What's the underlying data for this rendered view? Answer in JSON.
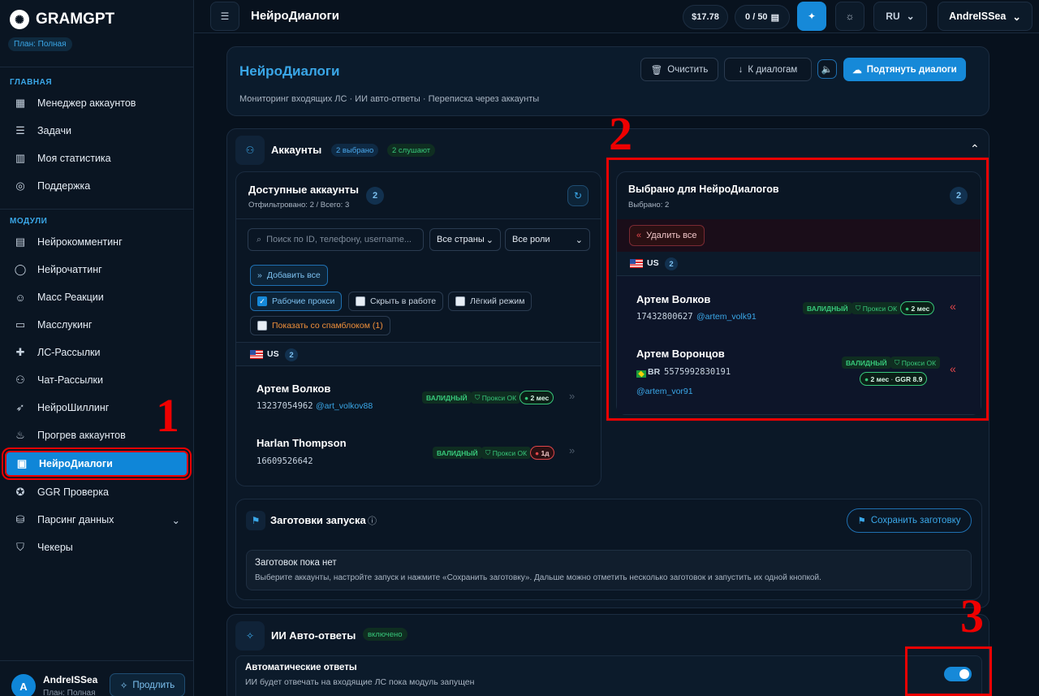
{
  "app": {
    "name": "GRAMGPT",
    "plan": "План: Полная"
  },
  "sidebar": {
    "section_main": "ГЛАВНАЯ",
    "main_items": [
      {
        "label": "Менеджер аккаунтов"
      },
      {
        "label": "Задачи"
      },
      {
        "label": "Моя статистика"
      },
      {
        "label": "Поддержка"
      }
    ],
    "section_modules": "МОДУЛИ",
    "module_items": [
      {
        "label": "Нейрокомментинг"
      },
      {
        "label": "Нейрочаттинг"
      },
      {
        "label": "Масс Реакции"
      },
      {
        "label": "Масслукинг"
      },
      {
        "label": "ЛС-Рассылки"
      },
      {
        "label": "Чат-Рассылки"
      },
      {
        "label": "НейроШиллинг"
      },
      {
        "label": "Прогрев аккаунтов"
      },
      {
        "label": "НейроДиалоги"
      },
      {
        "label": "GGR Проверка"
      },
      {
        "label": "Парсинг данных"
      },
      {
        "label": "Чекеры"
      }
    ],
    "user": {
      "initial": "A",
      "name": "AndreISSea",
      "plan": "План: Полная",
      "extend": "Продлить"
    }
  },
  "topbar": {
    "title": "НейроДиалоги",
    "balance": "$17.78",
    "quota": "0 / 50",
    "lang": "RU",
    "user": "AndreISSea"
  },
  "header_card": {
    "title": "НейроДиалоги",
    "subtitle": "Мониторинг входящих ЛС · ИИ авто-ответы · Переписка через аккаунты",
    "clear": "Очистить",
    "to_dialogs": "К диалогам",
    "pull": "Подтянуть диалоги"
  },
  "accounts": {
    "title": "Аккаунты",
    "selected_tag": "2 выбрано",
    "listening_tag": "2 слушают",
    "available": {
      "title": "Доступные аккаунты",
      "filtered": "Отфильтровано: 2 / Всего: 3",
      "count": "2",
      "search_placeholder": "Поиск по ID, телефону, username...",
      "country": "Все страны",
      "role": "Все роли",
      "add_all": "Добавить все",
      "filters": [
        {
          "label": "Рабочие прокси",
          "checked": true
        },
        {
          "label": "Скрыть в работе",
          "checked": false
        },
        {
          "label": "Лёгкий режим",
          "checked": false
        },
        {
          "label": "Показать со спамблоком (1)",
          "checked": false
        }
      ],
      "group": {
        "country": "US",
        "count": "2"
      },
      "rows": [
        {
          "name": "Артем Волков",
          "phone": "13237054962",
          "username": "@art_volkov88",
          "status": "ВАЛИДНЫЙ",
          "proxy": "Прокси ОК",
          "age": "2 мес"
        },
        {
          "name": "Harlan Thompson",
          "phone": "16609526642",
          "username": "",
          "status": "ВАЛИДНЫЙ",
          "proxy": "Прокси ОК",
          "age": "1д"
        }
      ]
    },
    "selected": {
      "title": "Выбрано для НейроДиалогов",
      "sub": "Выбрано: 2",
      "count": "2",
      "remove_all": "Удалить все",
      "group": {
        "country": "US",
        "count": "2"
      },
      "rows": [
        {
          "name": "Артем Волков",
          "phone": "17432800627",
          "username": "@artem_volk91",
          "status": "ВАЛИДНЫЙ",
          "proxy": "Прокси ОК",
          "age": "2 мес"
        },
        {
          "name": "Артем Воронцов",
          "geo": "BR",
          "phone": "5575992830191",
          "username": "@artem_vor91",
          "status": "ВАЛИДНЫЙ",
          "proxy": "Прокси ОК",
          "age": "2 мес",
          "ggr": "GGR 8.9"
        }
      ]
    }
  },
  "presets": {
    "title": "Заготовки запуска",
    "save": "Сохранить заготовку",
    "empty_title": "Заготовок пока нет",
    "empty_desc": "Выберите аккаунты, настройте запуск и нажмите «Сохранить заготовку». Дальше можно отметить несколько заготовок и запустить их одной кнопкой."
  },
  "ai": {
    "title": "ИИ Авто-ответы",
    "status": "включено",
    "auto_title": "Автоматические ответы",
    "auto_desc": "ИИ будет отвечать на входящие ЛС пока модуль запущен",
    "enabled": true
  },
  "annotations": [
    "1",
    "2",
    "3"
  ]
}
